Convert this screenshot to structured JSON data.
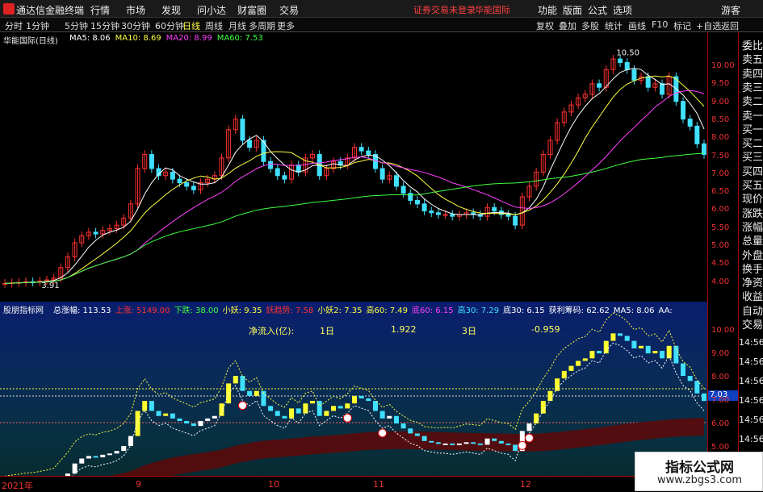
{
  "titlebar": {
    "app": "通达信金融终端",
    "menus": [
      "行情",
      "市场",
      "发现",
      "问小达",
      "财富圈",
      "交易"
    ],
    "notice": "证券交易未登录",
    "broker": "华能国际",
    "right": [
      "功能",
      "版面",
      "公式",
      "选项"
    ],
    "user": "游客"
  },
  "toolbar": {
    "periods": [
      "分时",
      "1分钟",
      "5分钟",
      "15分钟",
      "30分钟",
      "60分钟",
      "日线",
      "周线",
      "月线",
      "多周期",
      "更多"
    ],
    "selected": "日线",
    "right": [
      "复权",
      "叠加",
      "多股",
      "统计",
      "画线",
      "F10",
      "标记",
      "+自选",
      "返回"
    ]
  },
  "main": {
    "title": "华能国际(日线)",
    "ma": [
      {
        "label": "MA5: 8.06",
        "color": "#ffffff"
      },
      {
        "label": "MA10: 8.69",
        "color": "#ffff40"
      },
      {
        "label": "MA20: 8.99",
        "color": "#ff40ff"
      },
      {
        "label": "MA60: 7.53",
        "color": "#40ff40"
      }
    ],
    "high": "10.50",
    "low": "3.91",
    "axis": [
      "10.00",
      "9.50",
      "9.00",
      "8.50",
      "8.00",
      "7.50",
      "7.00",
      "6.50",
      "6.00",
      "5.50",
      "5.00",
      "4.50",
      "4.00"
    ]
  },
  "sub": {
    "title": "股朋指标网",
    "items": [
      {
        "t": "总涨幅: 113.53",
        "c": "#ffffff"
      },
      {
        "t": "上涨: 5149.00",
        "c": "#ff3030"
      },
      {
        "t": "下跌: 38.00",
        "c": "#40ff40"
      },
      {
        "t": "小妖: 9.35",
        "c": "#ffff40"
      },
      {
        "t": "妖趋势: 7.58",
        "c": "#ff3030"
      },
      {
        "t": "小妖2: 7.35",
        "c": "#ffff40"
      },
      {
        "t": "高60: 7.49",
        "c": "#ffff40"
      },
      {
        "t": "底60: 6.15",
        "c": "#ff40ff"
      },
      {
        "t": "高30: 7.29",
        "c": "#40e0ff"
      },
      {
        "t": "底30: 6.15",
        "c": "#ffffff"
      },
      {
        "t": "获利筹码: 62.62",
        "c": "#ffffff"
      },
      {
        "t": "MA5: 8.06",
        "c": "#ffffff"
      },
      {
        "t": "AA:",
        "c": "#ffffff"
      }
    ],
    "flow_label": "净流入(亿):",
    "d1": "1日",
    "v1": "1.922",
    "d3": "3日",
    "v3": "-0.959",
    "axis": [
      "10.00",
      "9.00",
      "8.00",
      "7.00",
      "6.00",
      "5.00"
    ],
    "price_tag": "7.03"
  },
  "side": [
    "委比",
    "卖五",
    "卖四",
    "卖三",
    "卖二",
    "卖一",
    "买一",
    "买二",
    "买三",
    "买四",
    "买五",
    "现价",
    "涨跌",
    "涨幅",
    "总量",
    "外盘",
    "换手",
    "净资",
    "收益",
    "自动",
    "交易"
  ],
  "side_axis": [
    "14:56",
    "14:56",
    "14:56",
    "14:56",
    "14:56",
    "14:56",
    "14:56",
    "14:56"
  ],
  "dates": [
    "2021年",
    "9",
    "10",
    "11",
    "12"
  ],
  "watermark": {
    "title": "指标公式网",
    "url": "www.zbgs3.com"
  },
  "chart_data": {
    "type": "candlestick",
    "x_label": "",
    "y_range": [
      3.8,
      10.6
    ],
    "close": [
      3.95,
      3.97,
      3.98,
      4.0,
      3.99,
      4.02,
      4.05,
      4.1,
      4.4,
      4.7,
      5.1,
      5.3,
      5.4,
      5.35,
      5.45,
      5.5,
      5.6,
      5.8,
      6.2,
      7.2,
      7.6,
      7.2,
      7.0,
      7.1,
      6.9,
      6.8,
      6.7,
      6.6,
      6.8,
      6.9,
      7.0,
      7.5,
      8.3,
      8.6,
      8.0,
      7.8,
      8.0,
      7.4,
      7.2,
      7.0,
      6.9,
      7.3,
      7.1,
      7.5,
      7.6,
      7.0,
      7.2,
      7.4,
      7.3,
      7.5,
      7.8,
      7.7,
      7.6,
      7.2,
      6.9,
      7.0,
      6.7,
      6.5,
      6.3,
      6.2,
      6.0,
      5.95,
      5.9,
      5.9,
      5.85,
      5.9,
      5.95,
      5.9,
      5.85,
      6.1,
      6.0,
      5.9,
      5.85,
      5.6,
      6.4,
      6.7,
      7.1,
      7.6,
      8.0,
      8.5,
      8.8,
      9.0,
      9.2,
      9.3,
      9.6,
      9.5,
      10.0,
      10.3,
      10.2,
      10.0,
      9.7,
      9.8,
      9.5,
      9.6,
      9.3,
      9.8,
      9.1,
      8.6,
      8.4,
      7.9,
      7.6
    ],
    "ma60_end": 7.53,
    "ma20_end": 8.99,
    "ma10_end": 8.69,
    "ma5_end": 8.06
  }
}
